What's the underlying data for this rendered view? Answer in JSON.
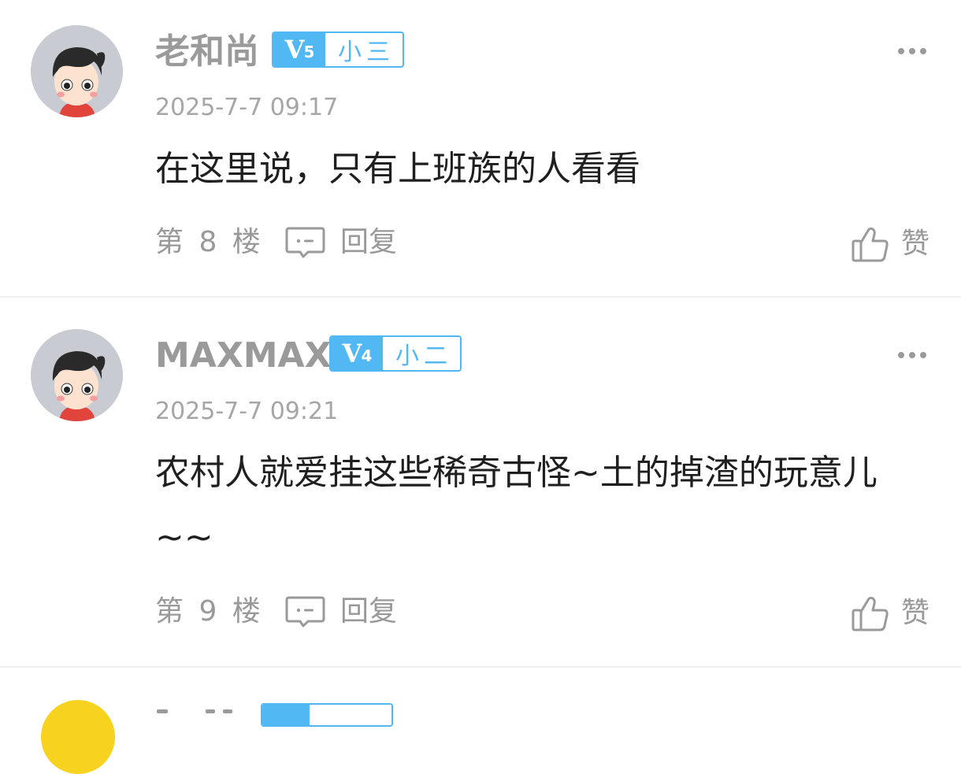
{
  "comments": [
    {
      "username": "老和尚",
      "level": "V",
      "level_num": "5",
      "rank": "小三",
      "timestamp": "2025-7-7 09:17",
      "content": "在这里说，只有上班族的人看看",
      "floor": "第 8 楼",
      "reply_label": "回复",
      "like_label": "赞"
    },
    {
      "username": "MAXMAX",
      "level": "V",
      "level_num": "4",
      "rank": "小二",
      "timestamp": "2025-7-7 09:21",
      "content": "农村人就爱挂这些稀奇古怪~土的掉渣的玩意儿~~",
      "floor": "第 9 楼",
      "reply_label": "回复",
      "like_label": "赞"
    }
  ],
  "colors": {
    "badge_blue": "#52b8f3",
    "meta_gray": "#9a9a9a",
    "next_avatar_yellow": "#f7d21e"
  },
  "icons": {
    "more": "more-dots-icon",
    "reply": "comment-bubble-icon",
    "like": "thumbs-up-icon"
  }
}
